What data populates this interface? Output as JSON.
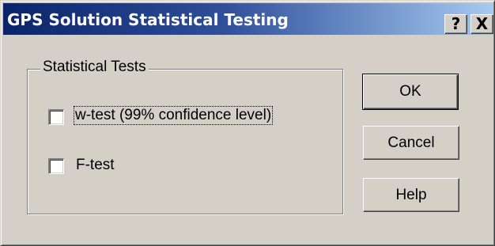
{
  "window": {
    "title": "GPS Solution Statistical Testing",
    "help_button": "?",
    "close_button": "X"
  },
  "group": {
    "label": "Statistical Tests",
    "checkboxes": [
      {
        "label": "w-test (99% confidence level)",
        "checked": false,
        "focused": true
      },
      {
        "label": "F-test",
        "checked": false,
        "focused": false
      }
    ]
  },
  "buttons": {
    "ok": "OK",
    "cancel": "Cancel",
    "help": "Help"
  },
  "colors": {
    "dialog_face": "#d4d0c8",
    "titlebar_start": "#0a246a",
    "titlebar_end": "#a6caf0",
    "title_text": "#ffffff"
  }
}
